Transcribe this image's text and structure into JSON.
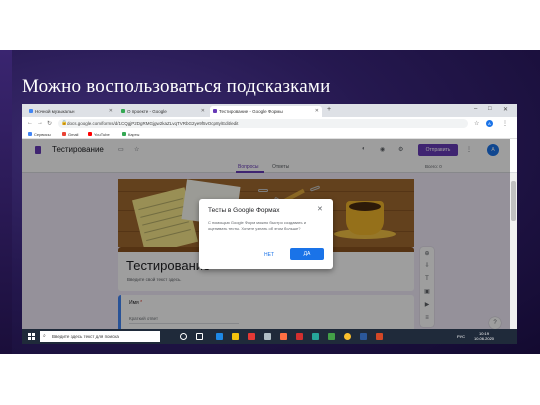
{
  "slide": {
    "title": "Можно воспользоваться подсказками"
  },
  "browser": {
    "tabs": [
      {
        "label": "Ночной музыкальн",
        "active": false,
        "color": "#4285f4"
      },
      {
        "label": "О проекте - Google",
        "active": false,
        "color": "#34a853"
      },
      {
        "label": "Тестирование - Google Формы",
        "active": true,
        "color": "#673ab7"
      }
    ],
    "window_controls": [
      "–",
      "□",
      "✕"
    ],
    "url": "docs.google.com/forms/d/1CQgjP2DgRMGjgw2kaZLvqTVRbG2ye9f5vOcp8y/Edit/edit",
    "bookmarks": [
      {
        "label": "Сервисы",
        "color": "#4285f4"
      },
      {
        "label": "Gmail",
        "color": "#ea4335"
      },
      {
        "label": "YouTube",
        "color": "#ff0000"
      },
      {
        "label": "Карты",
        "color": "#34a853"
      }
    ],
    "avatar_letter": "A"
  },
  "forms": {
    "doc_title": "Тестирование",
    "send_label": "Отправить",
    "avatar_letter": "A",
    "tab_questions": "Вопросы",
    "tab_answers": "Ответы",
    "points": "Всего: 0",
    "card_title": "Тестирование",
    "card_description": "Введите свой текст здесь.",
    "question_label": "Имя",
    "question_required_mark": "*",
    "question_hint": "Краткий ответ",
    "help_label": "?"
  },
  "dialog": {
    "title": "Тесты в Google Формах",
    "text": "С помощью Google Форм можно быстро создавать и оценивать тесты. Хотите узнать об этом больше?",
    "no_label": "НЕТ",
    "yes_label": "ДА",
    "close_label": "✕"
  },
  "taskbar": {
    "search_placeholder": "Введите здесь текст для поиска",
    "language": "РУС",
    "time": "10:19",
    "date": "10.06.2020"
  },
  "colors": {
    "accent": "#673ab7",
    "dialog_button": "#1a73e8",
    "slide_background": "#25184f",
    "header_band": "#8a5320"
  }
}
